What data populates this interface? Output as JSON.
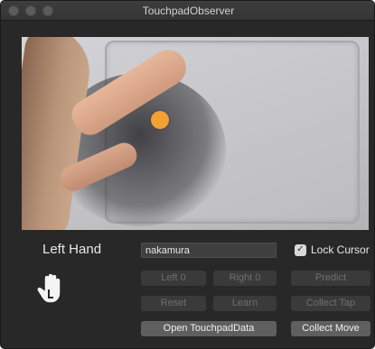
{
  "window": {
    "title": "TouchpadObserver"
  },
  "hand": {
    "label": "Left Hand",
    "icon": "left-hand-icon"
  },
  "name_field": {
    "value": "nakamura"
  },
  "lock_cursor": {
    "label": "Lock Cursor",
    "checked": true
  },
  "buttons": {
    "left0": "Left 0",
    "right0": "Right 0",
    "predict": "Predict",
    "reset": "Reset",
    "learn": "Learn",
    "collect_tap": "Collect Tap",
    "open_data": "Open TouchpadData",
    "collect_move": "Collect Move"
  },
  "colors": {
    "touch_point": "#f5a033",
    "window_bg": "#282828"
  }
}
